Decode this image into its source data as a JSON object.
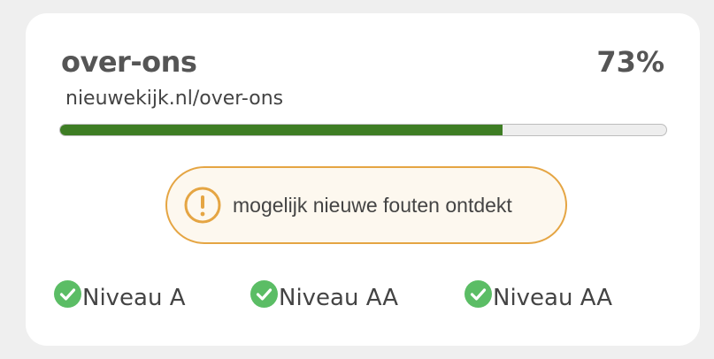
{
  "page": {
    "title": "over-ons",
    "url": "nieuwekijk.nl/over-ons",
    "score_label": "73%",
    "progress_percent": 73
  },
  "colors": {
    "progress_fill": "#3e7d24",
    "progress_track": "#eeeeee",
    "warning_border": "#e5a543",
    "warning_background": "#fdf8ef",
    "check_green": "#5bbd65"
  },
  "warning": {
    "icon": "exclamation-circle-icon",
    "text": "mogelijk nieuwe fouten ontdekt"
  },
  "levels": [
    {
      "icon": "check-circle-icon",
      "label": "Niveau A"
    },
    {
      "icon": "check-circle-icon",
      "label": "Niveau AA"
    },
    {
      "icon": "check-circle-icon",
      "label": "Niveau AA"
    }
  ]
}
